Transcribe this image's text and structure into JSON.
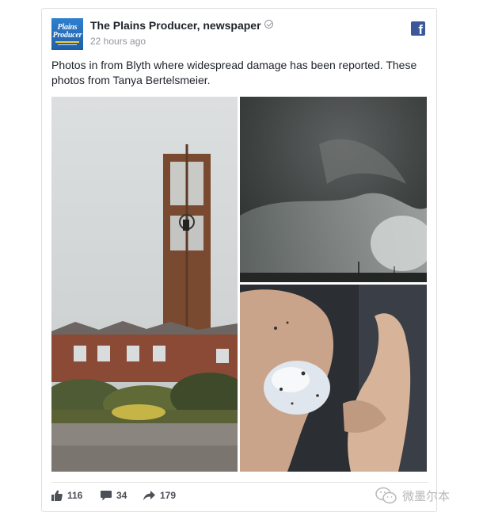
{
  "post": {
    "page_name": "The Plains Producer, newspaper",
    "timestamp": "22 hours ago",
    "avatar_lines": [
      "Plains",
      "Producer"
    ],
    "text": "Photos in from Blyth where widespread damage has been reported. These photos from Tanya Bertelsmeier.",
    "photos": [
      {
        "subject": "damaged church bell tower"
      },
      {
        "subject": "storm clouds"
      },
      {
        "subject": "hailstone in hands"
      }
    ]
  },
  "actions": {
    "likes": "116",
    "comments": "34",
    "shares": "179"
  },
  "watermark": {
    "text": "微墨尔本",
    "icon": "wechat-icon"
  },
  "colors": {
    "facebook_blue": "#3b5998",
    "meta_gray": "#90949c",
    "action_gray": "#4b4f56"
  }
}
